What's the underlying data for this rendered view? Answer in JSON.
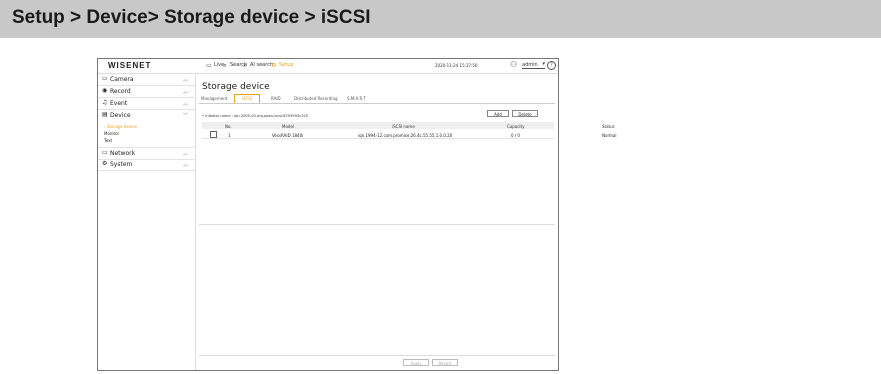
{
  "banner": {
    "title": "Setup > Device> Storage device > iSCSI"
  },
  "topbar": {
    "logo": "WISENET",
    "nav": [
      {
        "label": "Live",
        "icon": "monitor-icon"
      },
      {
        "label": "Search",
        "icon": "search-icon"
      },
      {
        "label": "AI search",
        "icon": "ai-search-icon"
      },
      {
        "label": "Setup",
        "icon": "gear-icon"
      }
    ],
    "datetime": "2020-11-24 15:37:56",
    "user": "admin"
  },
  "sidebar": {
    "items": [
      {
        "label": "Camera",
        "icon": "camera-icon"
      },
      {
        "label": "Record",
        "icon": "record-icon"
      },
      {
        "label": "Event",
        "icon": "bell-icon"
      },
      {
        "label": "Device",
        "icon": "device-icon"
      },
      {
        "label": "Network",
        "icon": "network-icon"
      },
      {
        "label": "System",
        "icon": "gear-icon"
      }
    ],
    "device_sub": [
      "Storage device",
      "Monitor",
      "Text"
    ]
  },
  "main": {
    "title": "Storage device",
    "tabs": [
      "Management",
      "iSCSI",
      "RAID",
      "Distributed Recording",
      "S.M.A.R.T"
    ],
    "initiator": "• Initiator name : iqn.2005-03.org.open-iscsi:8759593c325",
    "add_label": "Add",
    "delete_label": "Delete",
    "columns": [
      "No.",
      "Model",
      "iSCSI name",
      "Capacity",
      "Status"
    ],
    "rows": [
      {
        "no": "1",
        "model": "VessRAID 1840i",
        "iscsi_name": "iqn.1994-12.com.promise.26.4c.55.55.1.0.0.20",
        "capacity": "0 / 0",
        "status": "Normal"
      }
    ],
    "apply_label": "Apply",
    "revert_label": "Revert"
  },
  "colors": {
    "accent": "#e8a317",
    "banner_bg": "#c8c8c8"
  }
}
